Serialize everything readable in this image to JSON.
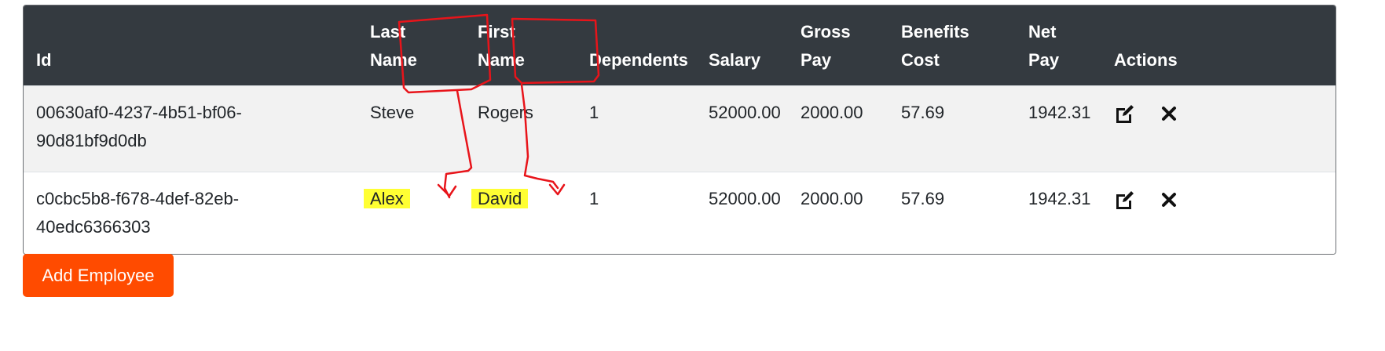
{
  "table": {
    "headers": {
      "id": "Id",
      "last_name_1": "Last",
      "last_name_2": "Name",
      "first_name_1": "First",
      "first_name_2": "Name",
      "dependents": "Dependents",
      "salary": "Salary",
      "gross_pay_1": "Gross",
      "gross_pay_2": "Pay",
      "benefits_cost_1": "Benefits",
      "benefits_cost_2": "Cost",
      "net_pay_1": "Net",
      "net_pay_2": "Pay",
      "actions": "Actions"
    },
    "rows": [
      {
        "id_1": "00630af0-4237-4b51-bf06-",
        "id_2": "90d81bf9d0db",
        "last_name": "Steve",
        "first_name": "Rogers",
        "dependents": "1",
        "salary": "52000.00",
        "gross_pay": "2000.00",
        "benefits_cost": "57.69",
        "net_pay": "1942.31"
      },
      {
        "id": "c0cbc5b8-f678-4def-82eb-40edc6366303",
        "last_name": "Alex",
        "first_name": "David",
        "dependents": "1",
        "salary": "52000.00",
        "gross_pay": "2000.00",
        "benefits_cost": "57.69",
        "net_pay": "1942.31"
      }
    ]
  },
  "add_button_label": "Add Employee",
  "icons": {
    "edit": "edit-icon",
    "delete": "close-icon"
  },
  "colors": {
    "header_bg": "#343a40",
    "row_striped_bg": "#f2f2f2",
    "add_button_bg": "#ff4b00",
    "highlight": "#ffff33",
    "annotation_red": "#e8141a"
  }
}
